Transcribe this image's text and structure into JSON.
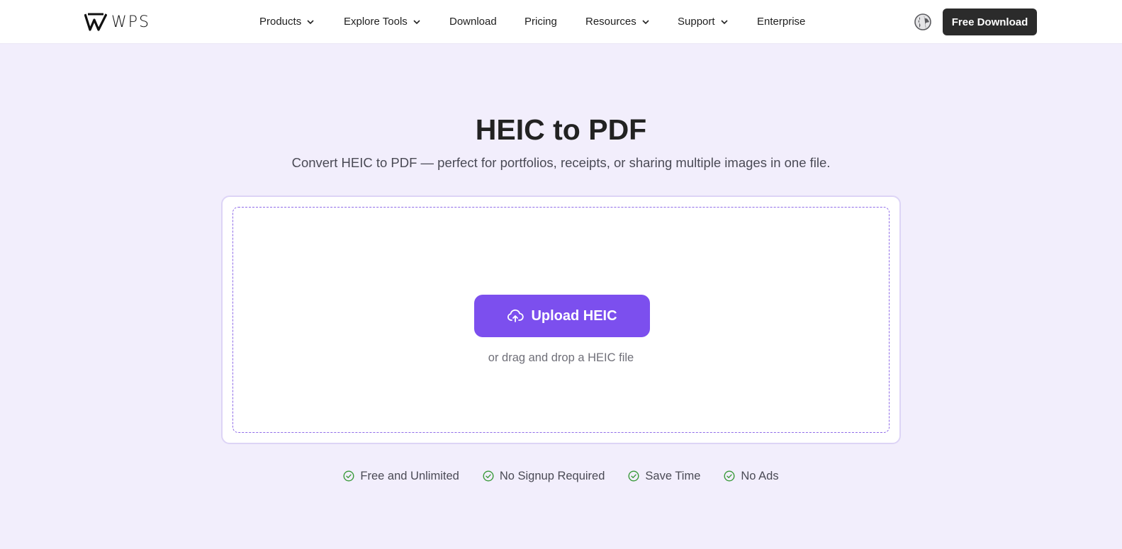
{
  "header": {
    "logo_text": "WPS",
    "nav": [
      {
        "label": "Products",
        "dropdown": true
      },
      {
        "label": "Explore Tools",
        "dropdown": true
      },
      {
        "label": "Download",
        "dropdown": false
      },
      {
        "label": "Pricing",
        "dropdown": false
      },
      {
        "label": "Resources",
        "dropdown": true
      },
      {
        "label": "Support",
        "dropdown": true
      },
      {
        "label": "Enterprise",
        "dropdown": false
      }
    ],
    "language_icon": "globe-icon",
    "cta_label": "Free Download"
  },
  "hero": {
    "title": "HEIC to PDF",
    "subtitle": "Convert HEIC to PDF — perfect for portfolios, receipts, or sharing multiple images in one file."
  },
  "upload": {
    "button_label": "Upload HEIC",
    "button_icon": "cloud-upload-icon",
    "drag_text": "or drag and drop a HEIC file"
  },
  "features": [
    {
      "label": "Free and Unlimited",
      "icon": "check-circle-icon"
    },
    {
      "label": "No Signup Required",
      "icon": "check-circle-icon"
    },
    {
      "label": "Save Time",
      "icon": "check-circle-icon"
    },
    {
      "label": "No Ads",
      "icon": "check-circle-icon"
    }
  ],
  "colors": {
    "accent": "#7c4fee",
    "background": "#f2eefc",
    "cta_dark": "#2b2b2b",
    "check_green": "#3a9a3a"
  }
}
